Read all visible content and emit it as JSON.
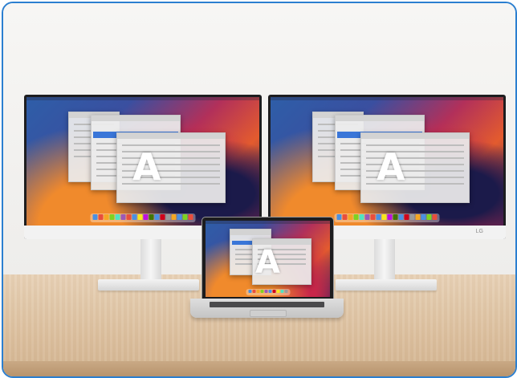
{
  "scene": {
    "monitor_brand": "LG",
    "screen_letter": "A",
    "accent": "#2b7fd0"
  }
}
